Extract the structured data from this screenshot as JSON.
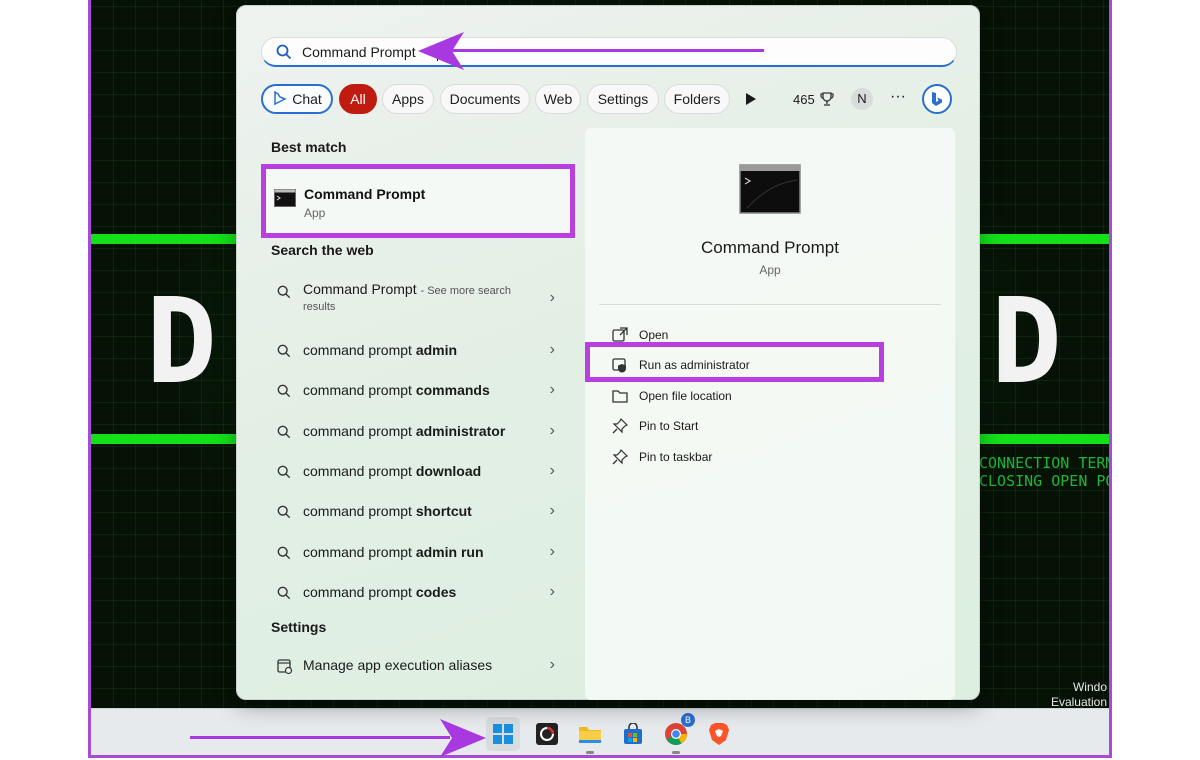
{
  "search": {
    "query": "Command Prompt"
  },
  "filters": {
    "chips": [
      "Chat",
      "All",
      "Apps",
      "Documents",
      "Web",
      "Settings",
      "Folders"
    ],
    "points": "465",
    "avatar": "N",
    "more": "···"
  },
  "best_match": {
    "section": "Best match",
    "name": "Command Prompt",
    "type": "App"
  },
  "web": {
    "section": "Search the web",
    "first_query": "Command Prompt",
    "first_suffix": "- See more search",
    "first_suffix2": "results",
    "items": [
      {
        "prefix": "command prompt ",
        "bold": "admin"
      },
      {
        "prefix": "command prompt ",
        "bold": "commands"
      },
      {
        "prefix": "command prompt ",
        "bold": "administrator"
      },
      {
        "prefix": "command prompt ",
        "bold": "download"
      },
      {
        "prefix": "command prompt ",
        "bold": "shortcut"
      },
      {
        "prefix": "command prompt ",
        "bold": "admin run"
      },
      {
        "prefix": "command prompt ",
        "bold": "codes"
      }
    ]
  },
  "settings": {
    "section": "Settings",
    "item": "Manage app execution aliases"
  },
  "detail": {
    "title": "Command Prompt",
    "subtitle": "App",
    "actions": [
      "Open",
      "Run as administrator",
      "Open file location",
      "Pin to Start",
      "Pin to taskbar"
    ]
  },
  "background": {
    "term_line1": "CONNECTION TERMI",
    "term_line2": "CLOSING OPEN POR",
    "watermark1": "Windo",
    "watermark2": "Evaluation"
  },
  "taskbar": {
    "badge": "B"
  },
  "colors": {
    "highlight": "#b93fe0",
    "active_chip": "#c01b10",
    "accent_blue": "#2a6fcf",
    "band_green": "#14e01a"
  }
}
